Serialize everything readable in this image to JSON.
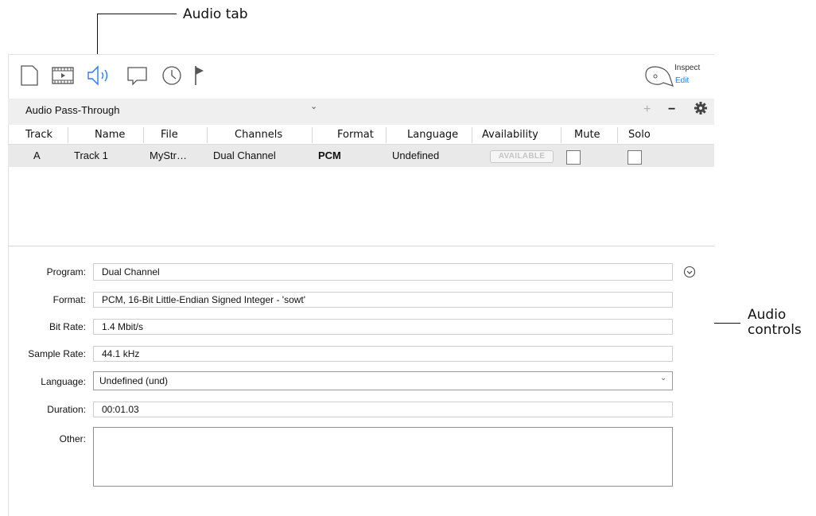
{
  "callouts": {
    "audio_tab": "Audio tab",
    "audio_controls_line1": "Audio",
    "audio_controls_line2": "controls"
  },
  "toolbar": {
    "tabs": [
      {
        "icon": "document-icon",
        "active": false
      },
      {
        "icon": "film-icon",
        "active": false
      },
      {
        "icon": "speaker-icon",
        "active": true
      },
      {
        "icon": "speech-bubble-icon",
        "active": false
      },
      {
        "icon": "clock-icon",
        "active": false
      },
      {
        "icon": "flag-icon",
        "active": false
      }
    ],
    "inspect_label": "Inspect",
    "edit_label": "Edit",
    "active_color": "#2a7de1"
  },
  "track_bar": {
    "selected": "Audio Pass-Through",
    "add_label": "+",
    "remove_label": "−",
    "settings_icon": "gear-icon"
  },
  "table": {
    "columns": [
      "Track",
      "Name",
      "File",
      "Channels",
      "Format",
      "Language",
      "Availability",
      "Mute",
      "Solo"
    ],
    "rows": [
      {
        "track": "A",
        "name": "Track 1",
        "file": "MyStr…",
        "channels": "Dual Channel",
        "format": "PCM",
        "language": "Undefined",
        "availability": "AVAILABLE",
        "mute": false,
        "solo": false
      }
    ]
  },
  "details": {
    "program_label": "Program:",
    "program_value": "Dual Channel",
    "format_label": "Format:",
    "format_value": "PCM, 16-Bit Little-Endian Signed Integer - 'sowt'",
    "bitrate_label": "Bit Rate:",
    "bitrate_value": "1.4 Mbit/s",
    "samplerate_label": "Sample Rate:",
    "samplerate_value": "44.1 kHz",
    "language_label": "Language:",
    "language_value": "Undefined (und)",
    "duration_label": "Duration:",
    "duration_value": "00:01.03",
    "other_label": "Other:",
    "other_value": ""
  }
}
